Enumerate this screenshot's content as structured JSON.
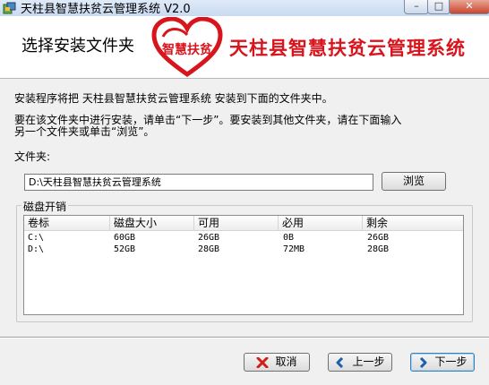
{
  "window": {
    "title": "天柱县智慧扶贫云管理系统 V2.0",
    "close_glyph": "✕",
    "minimize_glyph": "–",
    "maximize_glyph": "□"
  },
  "header": {
    "title": "选择安装文件夹",
    "logo_text": "智慧扶贫",
    "brand": "天柱县智慧扶贫云管理系统",
    "brand_color": "#d8141c"
  },
  "intro": {
    "line1": "安装程序将把 天柱县智慧扶贫云管理系统 安装到下面的文件夹中。",
    "line2": "要在该文件夹中进行安装，请单击“下一步”。要安装到其他文件夹，请在下面输入",
    "line3": "另一个文件夹或单击“浏览”。"
  },
  "folder": {
    "label": "文件夹:",
    "value": "D:\\天柱县智慧扶贫云管理系统",
    "browse_label": "浏览"
  },
  "disk": {
    "legend": "磁盘开销",
    "columns": [
      "卷标",
      "磁盘大小",
      "可用",
      "必用",
      "剩余"
    ],
    "rows": [
      [
        "C:\\",
        "60GB",
        "26GB",
        "0B",
        "26GB"
      ],
      [
        "D:\\",
        "52GB",
        "28GB",
        "72MB",
        "28GB"
      ]
    ]
  },
  "buttons": {
    "cancel": "取消",
    "back": "上一步",
    "next": "下一步"
  },
  "icons": {
    "app": "installer-app-icon",
    "cancel": "red-x-icon",
    "back": "left-arrow-icon",
    "next": "right-arrow-icon"
  }
}
